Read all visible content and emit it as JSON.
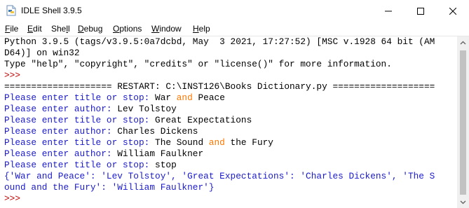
{
  "window": {
    "title": "IDLE Shell 3.9.5",
    "controls": [
      "minimize",
      "maximize",
      "close"
    ]
  },
  "menu": [
    {
      "pre": "",
      "u": "F",
      "post": "ile"
    },
    {
      "pre": "",
      "u": "E",
      "post": "dit"
    },
    {
      "pre": "She",
      "u": "l",
      "post": "l"
    },
    {
      "pre": "",
      "u": "D",
      "post": "ebug"
    },
    {
      "pre": "",
      "u": "O",
      "post": "ptions"
    },
    {
      "pre": "",
      "u": "W",
      "post": "indow"
    },
    {
      "pre": "",
      "u": "H",
      "post": "elp"
    }
  ],
  "shell": {
    "banner1": "Python 3.9.5 (tags/v3.9.5:0a7dcbd, May  3 2021, 17:27:52) [MSC v.1928 64 bit (AM",
    "banner2": "D64)] on win32",
    "banner3": "Type \"help\", \"copyright\", \"credits\" or \"license()\" for more information.",
    "prompt": ">>>",
    "restart": "==================== RESTART: C:\\INST126\\Books Dictionary.py ===================",
    "prompt_title": "Please enter title or stop: ",
    "prompt_author": "Please enter author: ",
    "inputs": {
      "title1_a": "War ",
      "title1_kw": "and",
      "title1_b": " Peace",
      "author1": "Lev Tolstoy",
      "title2": "Great Expectations",
      "author2": "Charles Dickens",
      "title3_a": "The Sound ",
      "title3_kw": "and",
      "title3_b": " the Fury",
      "author3": "William Faulkner",
      "title4": "stop"
    },
    "output1": "{'War and Peace': 'Lev Tolstoy', 'Great Expectations': 'Charles Dickens', 'The S",
    "output2": "ound and the Fury': 'William Faulkner'}",
    "final_prompt": ">>>"
  },
  "colors": {
    "stdout": "#1a1acd",
    "keyword": "#ff7700",
    "prompt": "#c00000"
  }
}
